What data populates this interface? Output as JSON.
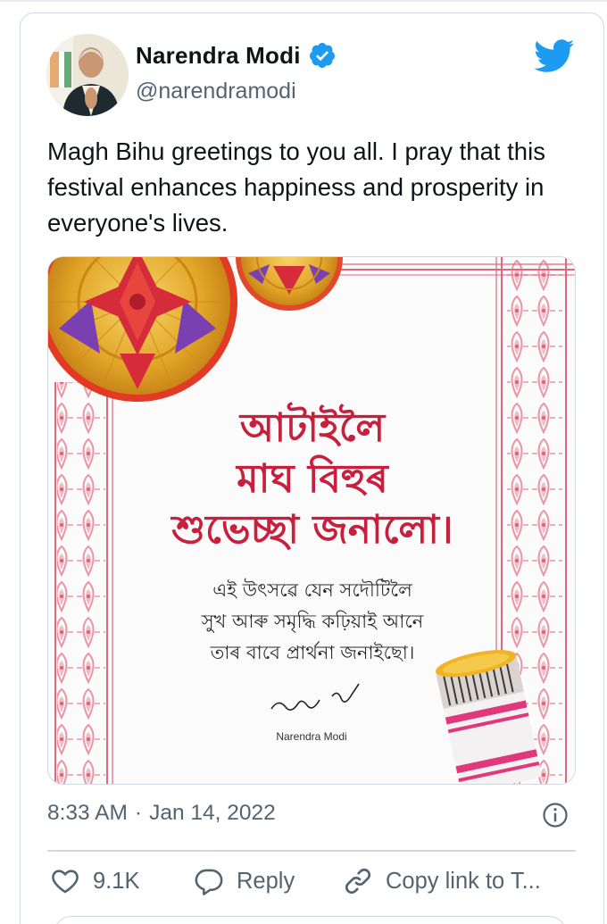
{
  "user": {
    "display_name": "Narendra Modi",
    "handle": "@narendramodi",
    "verified": true
  },
  "tweet": {
    "text": "Magh Bihu greetings to you all. I pray that this festival enhances happiness and prosperity in everyone's lives.",
    "time": "8:33 AM",
    "separator": "·",
    "date": "Jan 14, 2022"
  },
  "media": {
    "title_lines": [
      "আটাইলৈ",
      "মাঘ বিহুৰ",
      "শুভেচ্ছা জনালো।"
    ],
    "body_lines": [
      "এই উৎসৱে যেন সদৌটিলৈ",
      "সুখ আৰু সমৃদ্ধি কঢ়িয়াই আনে",
      "তাৰ বাবে প্ৰাৰ্থনা জনাইছো।"
    ],
    "signature_name": "Narendra Modi"
  },
  "actions": {
    "like_count": "9.1K",
    "reply_label": "Reply",
    "copy_label": "Copy link to T..."
  },
  "colors": {
    "twitter_blue": "#1d9bf0",
    "secondary_text": "#536471",
    "border": "#cfd9de",
    "title_red": "#c8203c"
  },
  "icons": [
    "verified-icon",
    "twitter-logo-icon",
    "info-icon",
    "heart-icon",
    "reply-icon",
    "link-icon"
  ]
}
